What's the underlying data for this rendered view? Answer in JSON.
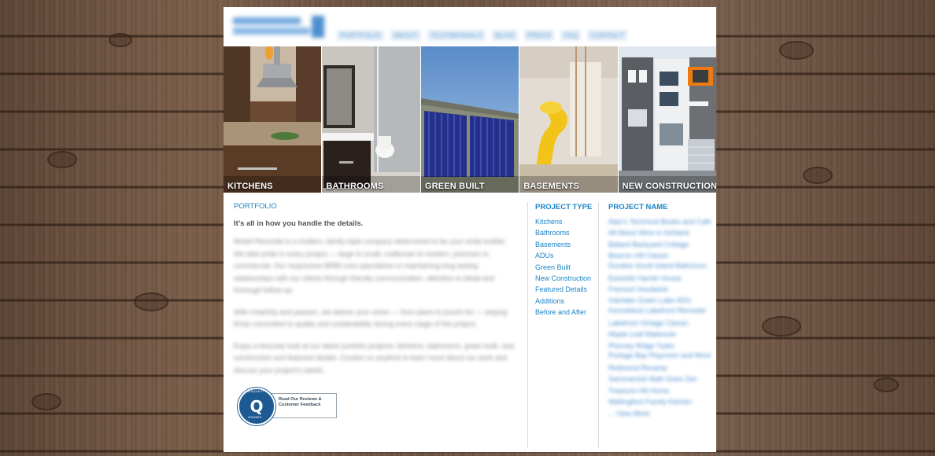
{
  "header": {
    "logo_text": "MODERN REMODEL",
    "nav": [
      "PORTFOLIO",
      "ABOUT",
      "TESTIMONIALS",
      "BLOG",
      "PRESS",
      "FAQ",
      "CONTACT"
    ]
  },
  "banner": {
    "tiles": [
      {
        "label": "KITCHENS"
      },
      {
        "label": "BATHROOMS"
      },
      {
        "label": "GREEN BUILT"
      },
      {
        "label": "BASEMENTS"
      },
      {
        "label": "NEW CONSTRUCTION"
      }
    ]
  },
  "main": {
    "title": "PORTFOLIO",
    "tagline": "It’s all in how you handle the details.",
    "paragraphs": [
      "Model Remodel is a modern, family-style company determined to be your smile builder. We take pride in every project — large to small, craftsman to modern, premium to commercial. Our responsive MRM crew specializes in maintaining long lasting relationships with our clients through friendly communication, attention to detail and thorough follow-up.",
      "With creativity and passion, we deliver your vision — from plans to punch list — staying firmly committed to quality and sustainability during every stage of the project.",
      "Enjoy a leisurely look at our latest portfolio projects: kitchens, bathrooms, green built, new construction and featured details. Contact us anytime to learn more about our work and discuss your project's needs."
    ],
    "badge": {
      "letter": "Q",
      "ring_top": "GUILDQUALITY",
      "ring_bottom": "MEMBER",
      "text_line1": "Read Our Reviews &",
      "text_line2": "Customer Feedback"
    }
  },
  "project_type": {
    "title": "PROJECT TYPE",
    "items": [
      "Kitchens",
      "Bathrooms",
      "Basements",
      "ADUs",
      "Green Built",
      "New Construction",
      "Featured Details",
      "Additions",
      "Before and After"
    ]
  },
  "project_name": {
    "title": "PROJECT NAME",
    "items": [
      "Alan's Technical Books and Cafe",
      "All About Wine in Ashland",
      "Ballard Backyard Cottage",
      "Beacon Hill Classic",
      "Dundee Scroll Island Bathroom",
      "Eastside Harrier House",
      "Fremont Hoodwink",
      "Interlake Green Lake ADU",
      "Kennebeck Lakefront Remodel",
      "Lakefront Vintage Classic",
      "Maple Leaf Makeover",
      "Phinney Ridge Tudor",
      "Portage Bay Playroom and More",
      "Redmond Revamp",
      "Sammamish Bath Goes Zen",
      "Treasure Hill Home",
      "Wallingford Family Kitchen",
      "... View More"
    ]
  }
}
